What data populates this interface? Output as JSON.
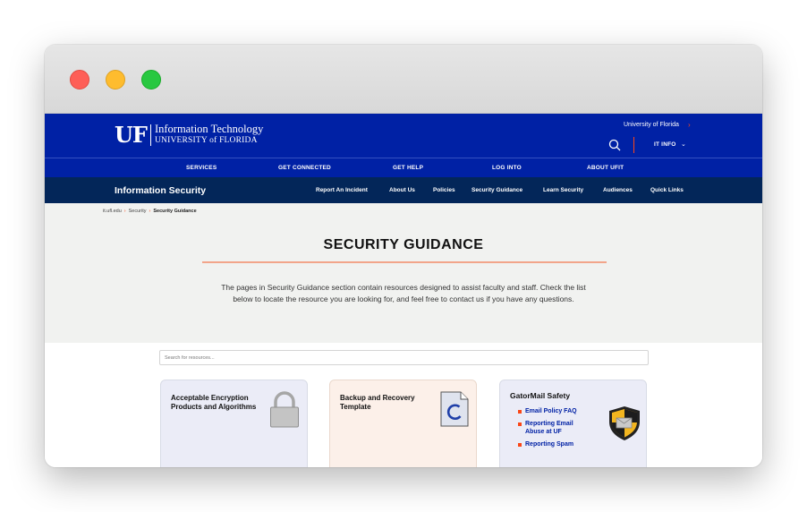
{
  "header": {
    "logo_mark": "UF",
    "logo_line1": "Information Technology",
    "logo_line2": "UNIVERSITY of FLORIDA",
    "uf_link": "University of Florida",
    "itinfo_label": "IT INFO",
    "brand_blue": "#0021a5",
    "accent_orange": "#fa4616"
  },
  "primary_nav": [
    "SERVICES",
    "GET CONNECTED",
    "GET HELP",
    "LOG INTO",
    "ABOUT UFIT"
  ],
  "secondary_nav": {
    "site_title": "Information Security",
    "links": [
      "Report An Incident",
      "About Us",
      "Policies",
      "Security Guidance",
      "Learn Security",
      "Audiences",
      "Quick Links"
    ],
    "bg_color": "#032659"
  },
  "breadcrumb": [
    "it.ufl.edu",
    "Security",
    "Security Guidance"
  ],
  "page": {
    "title": "SECURITY GUIDANCE",
    "intro": "The pages in Security Guidance section contain resources designed to assist faculty and staff. Check the list below to locate the resource you are looking for, and feel free to contact us if you have any questions."
  },
  "search": {
    "placeholder": "Search for resources..."
  },
  "cards": [
    {
      "title": "Acceptable Encryption Products and Algorithms",
      "icon": "padlock-icon"
    },
    {
      "title": "Backup and Recovery Template",
      "icon": "refresh-document-icon"
    },
    {
      "title": "GatorMail Safety",
      "icon": "mail-shield-icon",
      "links": [
        "Email Policy FAQ",
        "Reporting Email Abuse at UF",
        "Reporting Spam"
      ]
    }
  ]
}
